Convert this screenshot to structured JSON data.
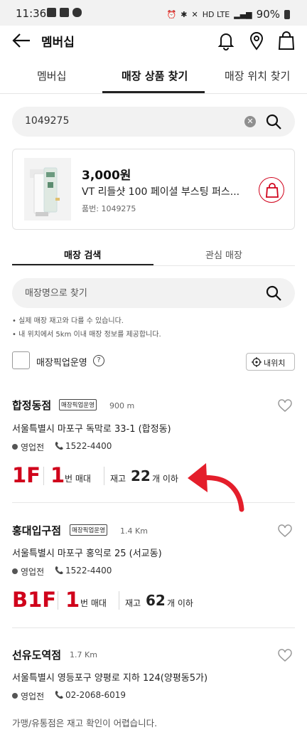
{
  "status_bar": {
    "time": "11:36",
    "network": "HD LTE",
    "battery": "90%"
  },
  "header": {
    "title": "멤버십",
    "icons": [
      "back-arrow-icon",
      "bell-icon",
      "location-pin-icon",
      "shopping-bag-icon"
    ]
  },
  "main_tabs": [
    {
      "label": "멤버십"
    },
    {
      "label": "매장 상품 찾기"
    },
    {
      "label": "매장 위치 찾기"
    }
  ],
  "search": {
    "value": "1049275"
  },
  "product": {
    "price": "3,000원",
    "name": "VT 리들샷 100 페이셜 부스팅 퍼스...",
    "code_label": "품번: 1049275"
  },
  "sub_tabs": [
    {
      "label": "매장 검색"
    },
    {
      "label": "관심 매장"
    }
  ],
  "store_search": {
    "placeholder": "매장명으로 찾기"
  },
  "notices": [
    "• 실제 매장 재고와 다를 수 있습니다.",
    "• 내 위치에서 5km 이내 매장 정보를 제공합니다."
  ],
  "filter": {
    "pickup_label": "매장픽업운영",
    "help": "?",
    "my_location_label": "내위치"
  },
  "stores": [
    {
      "name": "합정동점",
      "badge": "매장픽업운영",
      "distance": "900 m",
      "address": "서울특별시 마포구 독막로 33-1 (합정동)",
      "status": "영업전",
      "phone": "1522-4400",
      "floor": "1F",
      "shelf_number": "1",
      "shelf_unit": "번 매대",
      "stock_prefix": "재고",
      "stock": "22",
      "stock_suffix": "개 이하"
    },
    {
      "name": "홍대입구점",
      "badge": "매장픽업운영",
      "distance": "1.4 Km",
      "address": "서울특별시 마포구 홍익로 25 (서교동)",
      "status": "영업전",
      "phone": "1522-4400",
      "floor": "B1F",
      "shelf_number": "1",
      "shelf_unit": "번 매대",
      "stock_prefix": "재고",
      "stock": "62",
      "stock_suffix": "개 이하"
    },
    {
      "name": "선유도역점",
      "distance": "1.7 Km",
      "address": "서울특별시 영등포구 양평로 지하 124(양평동5가)",
      "status": "영업전",
      "phone": "02-2068-6019"
    }
  ],
  "footer_note": "가맹/유통점은 재고 확인이 어렵습니다.",
  "colors": {
    "accent_red": "#d0021b",
    "annotation_arrow": "#e41e2b"
  }
}
